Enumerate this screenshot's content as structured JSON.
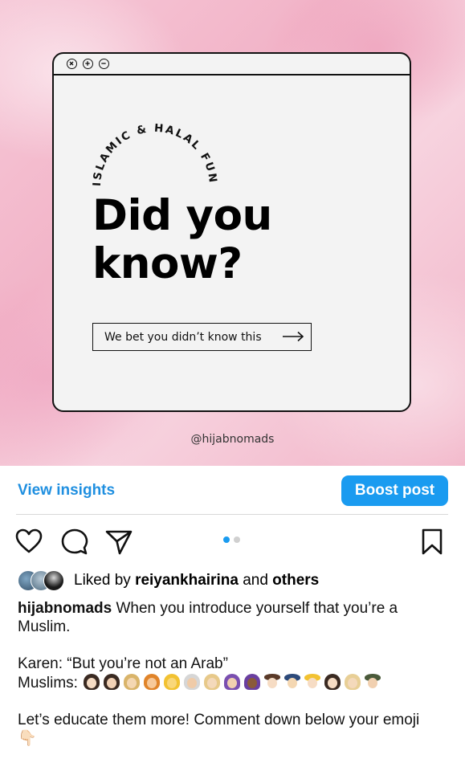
{
  "post_image": {
    "window_controls": [
      "close-icon",
      "plus-icon",
      "minus-icon"
    ],
    "arc_text": "ISLAMIC & HALAL FUN FACTS",
    "headline_line1": "Did you",
    "headline_line2": "know?",
    "cta_label": "We bet you didn’t know this",
    "cta_icon": "arrow-right-icon",
    "handle": "@hijabnomads"
  },
  "insights": {
    "view_label": "View insights",
    "boost_label": "Boost post"
  },
  "actions": {
    "icons": [
      "heart-icon",
      "comment-icon",
      "share-icon",
      "bookmark-icon"
    ],
    "carousel_index": 1,
    "carousel_total": 2
  },
  "likes": {
    "prefix": "Liked by",
    "user": "reiyankhairina",
    "middle": "and",
    "others": "others"
  },
  "caption": {
    "username": "hijabnomads",
    "line1": "When you introduce yourself that you’re a Muslim.",
    "line2": "Karen: “But you’re not an Arab”",
    "line3_prefix": "Muslims:",
    "line4": "Let’s educate them more! Comment down below your emoji",
    "pointing_emoji": "👇🏻"
  },
  "colors": {
    "accent": "#1a9bf0",
    "link": "#1f8fe0",
    "background_pink": "#f2b4c8"
  }
}
